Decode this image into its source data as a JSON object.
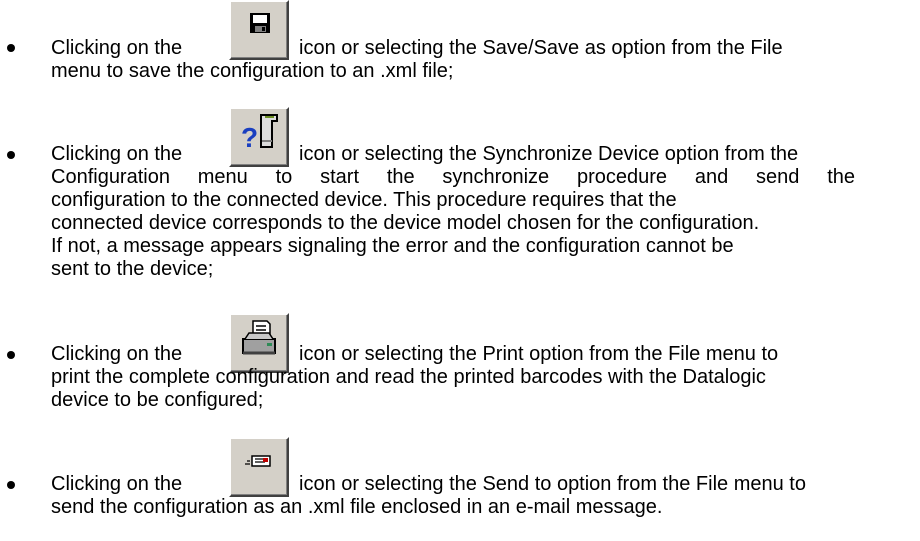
{
  "items": [
    {
      "icon": "save-icon",
      "pre": "Clicking on the",
      "lines": [
        "icon or selecting the Save/Save as option from the File",
        "menu to save the configuration to an .xml file;"
      ]
    },
    {
      "icon": "synchronize-device-icon",
      "pre": "Clicking on the",
      "lines": [
        "icon or selecting the Synchronize Device option from the",
        "Configuration menu to start the synchronize procedure and send the",
        "configuration to the connected device. This procedure requires that the",
        "connected device corresponds to the device model chosen for the configuration.",
        "If not, a message appears signaling the error and the configuration cannot be",
        "sent to the device;"
      ]
    },
    {
      "icon": "print-icon",
      "pre": "Clicking on the",
      "lines": [
        "icon or selecting the Print option from the File menu to",
        "print the complete configuration and read the printed barcodes with the Datalogic",
        "device to be configured;"
      ]
    },
    {
      "icon": "send-to-icon",
      "pre": "Clicking on the",
      "lines": [
        "icon or selecting the Send to option from the File menu to",
        "send the configuration as an .xml file enclosed in an e-mail message."
      ]
    }
  ]
}
